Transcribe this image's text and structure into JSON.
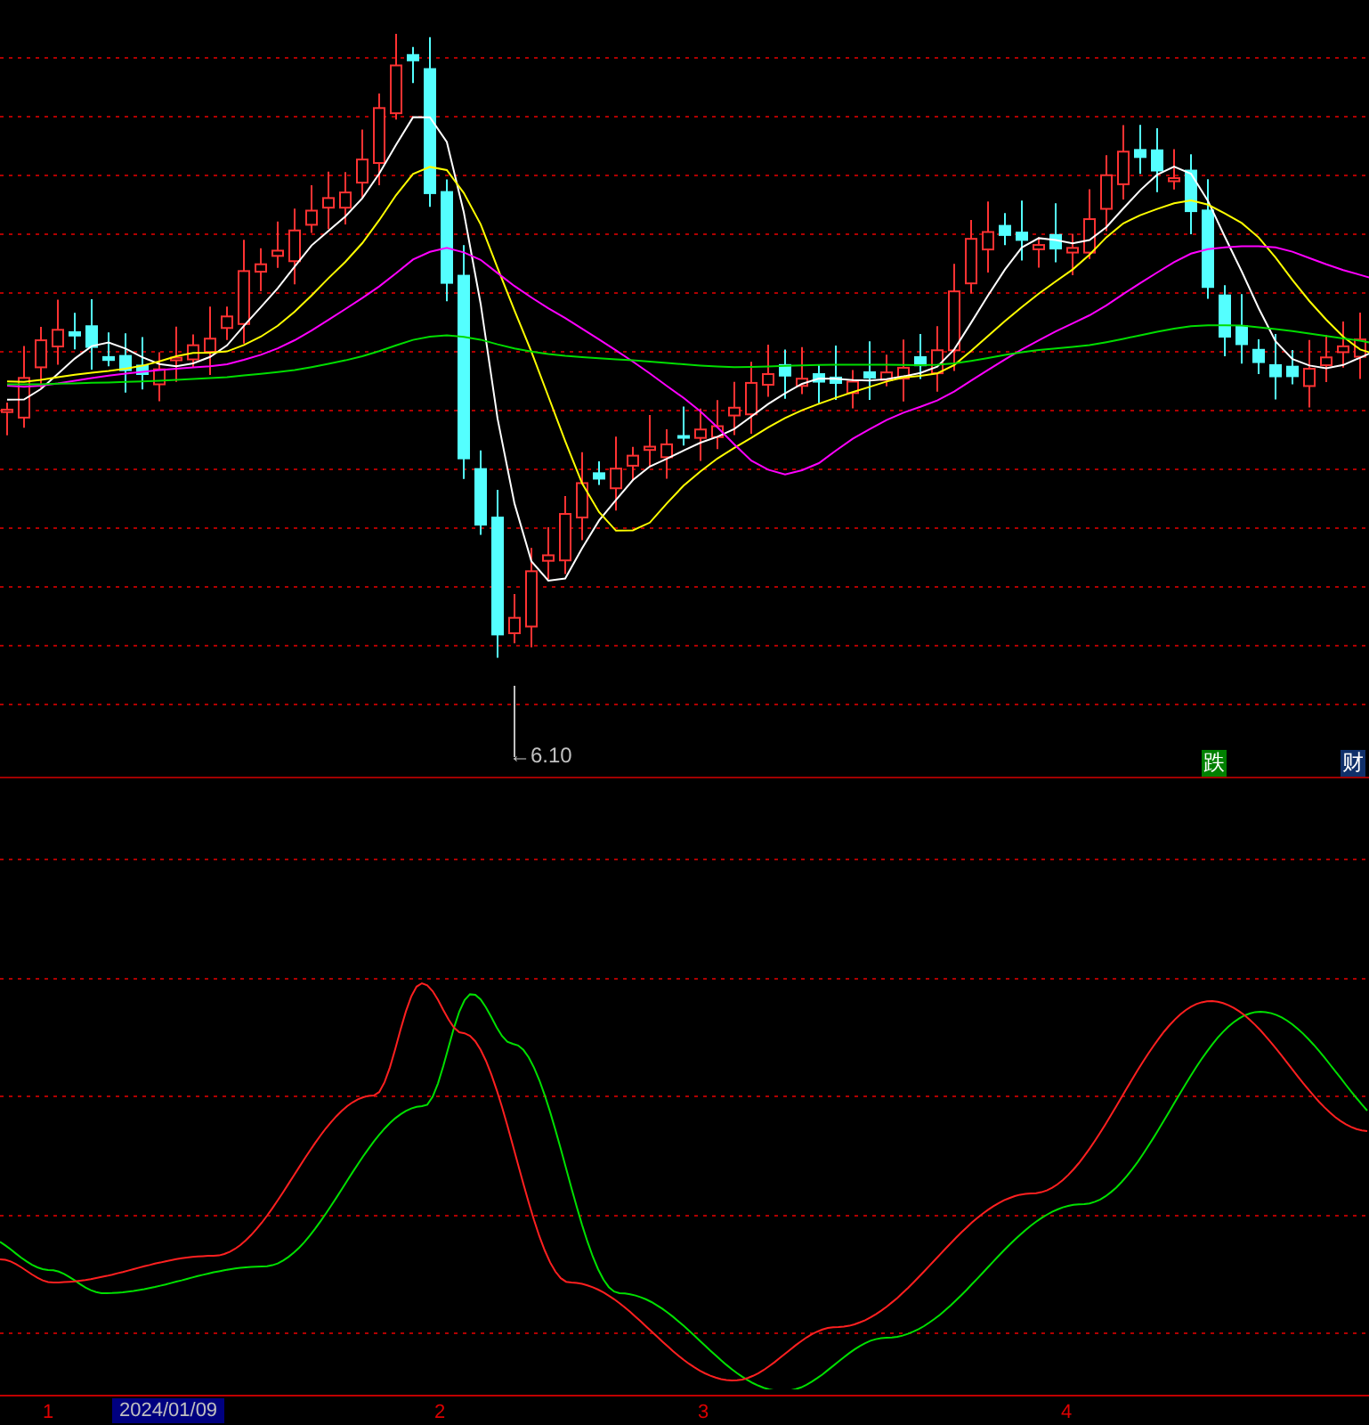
{
  "price_panel": {
    "low_label": "←6.10",
    "badges": [
      {
        "text": "跌",
        "color": "#008000"
      },
      {
        "text": "财",
        "color": "#10306a"
      }
    ]
  },
  "time_axis": {
    "labels": [
      {
        "text": "1",
        "kind": "month"
      },
      {
        "text": "2024/01/09",
        "kind": "cursor-date"
      },
      {
        "text": "2",
        "kind": "month"
      },
      {
        "text": "3",
        "kind": "month"
      },
      {
        "text": "4",
        "kind": "month"
      }
    ]
  }
}
